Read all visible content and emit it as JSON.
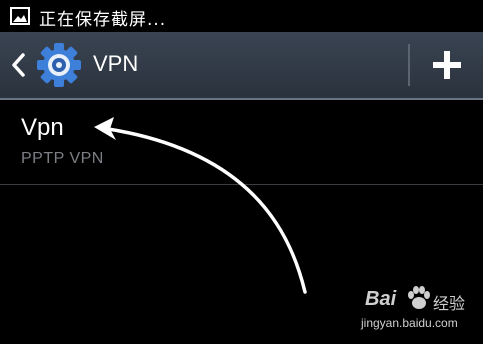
{
  "status_bar": {
    "screenshot_icon": "image-icon",
    "text": "正在保存截屏..."
  },
  "action_bar": {
    "back_icon": "chevron-left-icon",
    "settings_icon": "gear-icon",
    "title": "VPN",
    "add_icon": "plus-icon"
  },
  "vpn_list": {
    "items": [
      {
        "name": "Vpn",
        "type": "PPTP VPN"
      }
    ]
  },
  "annotation": {
    "arrow": "curved-arrow-icon"
  },
  "watermark": {
    "brand": "Bai",
    "experience": "经验",
    "url": "jingyan.baidu.com"
  },
  "colors": {
    "background": "#000000",
    "action_bar": "#333c48",
    "subtitle": "#7c7f85",
    "gear_blue": "#3d7fd9"
  }
}
